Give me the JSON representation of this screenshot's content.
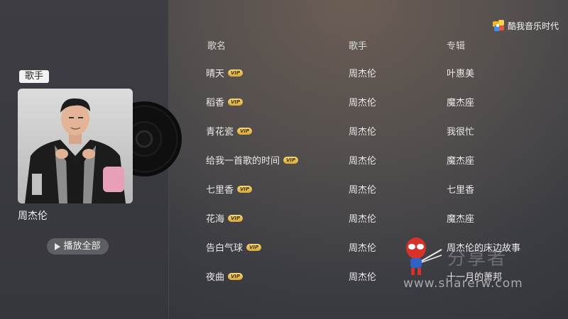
{
  "brand": {
    "name": "酷我音乐时代",
    "icon": "cube-app-icon"
  },
  "sidebar": {
    "section_tag": "歌手",
    "artist_name": "周杰伦",
    "play_all_label": "播放全部"
  },
  "table": {
    "headers": {
      "song": "歌名",
      "artist": "歌手",
      "album": "专辑"
    },
    "vip_label": "VIP",
    "rows": [
      {
        "song": "晴天",
        "artist": "周杰伦",
        "album": "叶惠美",
        "vip": true
      },
      {
        "song": "稻香",
        "artist": "周杰伦",
        "album": "魔杰座",
        "vip": true
      },
      {
        "song": "青花瓷",
        "artist": "周杰伦",
        "album": "我很忙",
        "vip": true
      },
      {
        "song": "给我一首歌的时间",
        "artist": "周杰伦",
        "album": "魔杰座",
        "vip": true
      },
      {
        "song": "七里香",
        "artist": "周杰伦",
        "album": "七里香",
        "vip": true
      },
      {
        "song": "花海",
        "artist": "周杰伦",
        "album": "魔杰座",
        "vip": true
      },
      {
        "song": "告白气球",
        "artist": "周杰伦",
        "album": "周杰伦的床边故事",
        "vip": true
      },
      {
        "song": "夜曲",
        "artist": "周杰伦",
        "album": "十一月的萧邦",
        "vip": true
      }
    ]
  },
  "watermark": {
    "title": "分享者",
    "url": "www.sharerw.com"
  },
  "colors": {
    "vip_badge": "#e8c25a",
    "background": "#45444a",
    "panel": "#3a3a40"
  }
}
